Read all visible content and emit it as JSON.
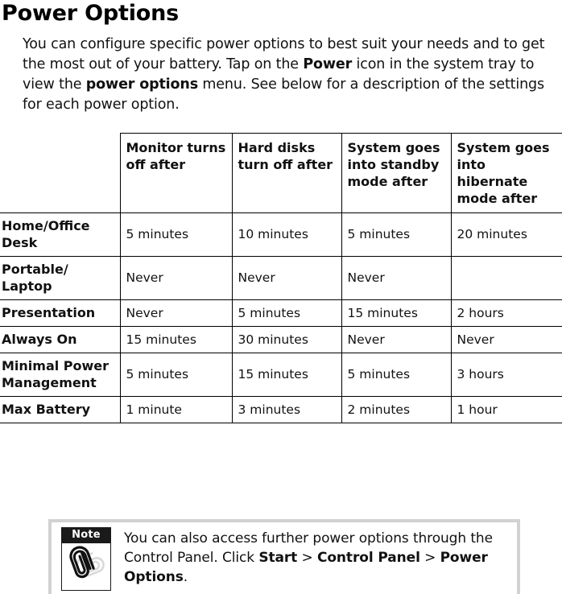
{
  "page": {
    "title": "Power Options"
  },
  "intro": {
    "part1": "You can configure specific power options to best suit your needs and to get the most out of your battery. Tap on the ",
    "bold1": "Power",
    "part2": " icon in the system tray to view the ",
    "bold2": "power options",
    "part3": " menu. See below for a description of the settings for each power option."
  },
  "table": {
    "headers": [
      "",
      "Monitor turns off after",
      "Hard disks turn off after",
      "System goes into standby mode after",
      "System goes into hibernate mode after"
    ],
    "rows": [
      {
        "name": "Home/Office Desk",
        "values": [
          "5 minutes",
          "10 minutes",
          "5 minutes",
          "20 minutes"
        ]
      },
      {
        "name": "Portable/ Laptop",
        "values": [
          "Never",
          "Never",
          "Never",
          ""
        ]
      },
      {
        "name": "Presentation",
        "values": [
          "Never",
          "5 minutes",
          "15 minutes",
          "2 hours"
        ]
      },
      {
        "name": "Always On",
        "values": [
          "15 minutes",
          "30 minutes",
          "Never",
          "Never"
        ]
      },
      {
        "name": "Minimal Power Management",
        "values": [
          "5 minutes",
          "15 minutes",
          "5 minutes",
          "3 hours"
        ]
      },
      {
        "name": "Max Battery",
        "values": [
          "1 minute",
          "3 minutes",
          "2 minutes",
          "1 hour"
        ]
      }
    ]
  },
  "note": {
    "label": "Note",
    "icon": "paperclip-icon",
    "text_part1": "You can also access further power options through the Control Panel. Click ",
    "bold1": "Start",
    "sep1": " > ",
    "bold2": "Control Panel",
    "sep2": " > ",
    "bold3": "Power Options",
    "text_end": "."
  },
  "colors": {
    "text": "#111111",
    "rule": "#000000",
    "note_border": "#d2d2d2",
    "note_label_bg": "#1a1a1a"
  }
}
